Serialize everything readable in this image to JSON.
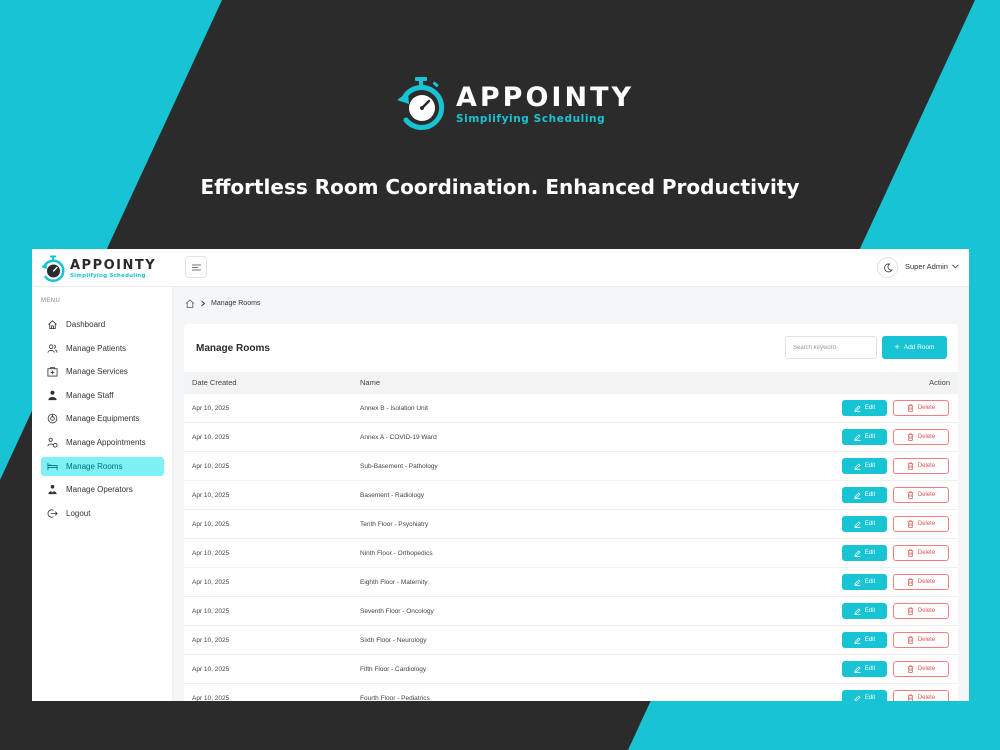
{
  "colors": {
    "accent": "#18c4d4",
    "dark_bg": "#2b2b2b",
    "active_nav_bg": "#80f0f7",
    "delete_red": "#e05555"
  },
  "promo": {
    "brand": "APPOINTY",
    "tagline": "Simplifying Scheduling",
    "headline": "Effortless Room Coordination. Enhanced Productivity"
  },
  "app": {
    "brand": "APPOINTY",
    "tagline": "Simplifying Scheduling",
    "header": {
      "user_label": "Super Admin"
    },
    "sidebar": {
      "menu_label": "MENU",
      "items": [
        {
          "label": "Dashboard",
          "icon": "home-icon"
        },
        {
          "label": "Manage Patients",
          "icon": "users-icon"
        },
        {
          "label": "Manage Services",
          "icon": "medical-kit-icon"
        },
        {
          "label": "Manage Staff",
          "icon": "doctor-icon"
        },
        {
          "label": "Manage Equipments",
          "icon": "equipment-icon"
        },
        {
          "label": "Manage Appointments",
          "icon": "appointment-icon"
        },
        {
          "label": "Manage Rooms",
          "icon": "bed-icon",
          "active": true
        },
        {
          "label": "Manage Operators",
          "icon": "operator-icon"
        },
        {
          "label": "Logout",
          "icon": "logout-icon"
        }
      ]
    },
    "breadcrumb": {
      "current": "Manage Rooms"
    },
    "page": {
      "title": "Manage Rooms",
      "search_placeholder": "Search keyword",
      "add_button": "Add Room",
      "columns": {
        "date": "Date Created",
        "name": "Name",
        "action": "Action"
      },
      "edit_label": "Edit",
      "delete_label": "Delete",
      "rows": [
        {
          "date": "Apr 10, 2025",
          "name": "Annex B - Isolation Unit"
        },
        {
          "date": "Apr 10, 2025",
          "name": "Annex A - COVID-19 Ward"
        },
        {
          "date": "Apr 10, 2025",
          "name": "Sub-Basement - Pathology"
        },
        {
          "date": "Apr 10, 2025",
          "name": "Basement - Radiology"
        },
        {
          "date": "Apr 10, 2025",
          "name": "Tenth Floor - Psychiatry"
        },
        {
          "date": "Apr 10, 2025",
          "name": "Ninth Floor - Orthopedics"
        },
        {
          "date": "Apr 10, 2025",
          "name": "Eighth Floor - Maternity"
        },
        {
          "date": "Apr 10, 2025",
          "name": "Seventh Floor - Oncology"
        },
        {
          "date": "Apr 10, 2025",
          "name": "Sixth Floor - Neurology"
        },
        {
          "date": "Apr 10, 2025",
          "name": "Fifth Floor - Cardiology"
        },
        {
          "date": "Apr 10, 2025",
          "name": "Fourth Floor - Pediatrics"
        }
      ]
    }
  }
}
